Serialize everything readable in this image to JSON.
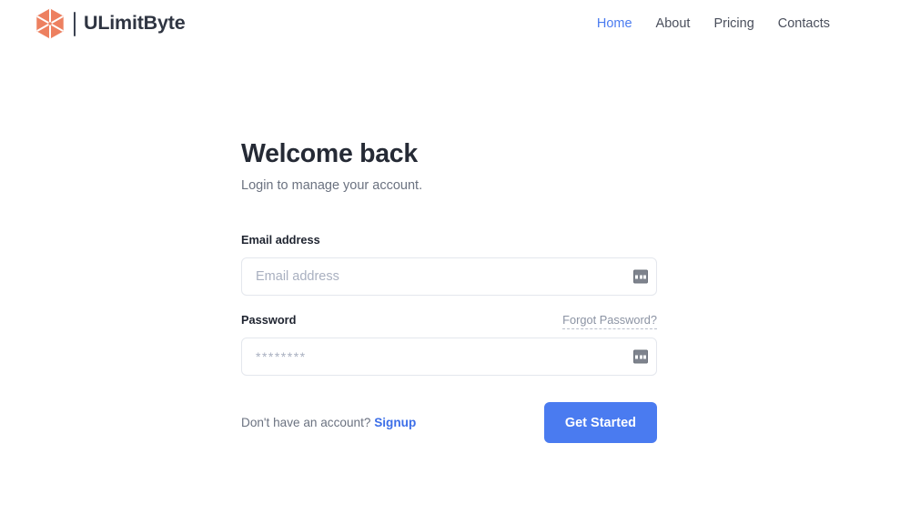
{
  "brand": {
    "name": "ULimitByte",
    "logo_icon": "hexagon-cube-icon",
    "logo_color": "#ed8060"
  },
  "nav": {
    "items": [
      {
        "label": "Home",
        "active": true
      },
      {
        "label": "About",
        "active": false
      },
      {
        "label": "Pricing",
        "active": false
      },
      {
        "label": "Contacts",
        "active": false
      }
    ],
    "active_color": "#4a7bf0",
    "inactive_color": "#4a4f5c"
  },
  "main": {
    "title": "Welcome back",
    "subtitle": "Login to manage your account."
  },
  "form": {
    "email": {
      "label": "Email address",
      "placeholder": "Email address",
      "value": "",
      "adornment_icon": "autofill-dots-icon"
    },
    "password": {
      "label": "Password",
      "placeholder": "********",
      "value": "",
      "adornment_icon": "autofill-dots-icon",
      "forgot_label": "Forgot Password?"
    },
    "signup_prompt": "Don't have an account?",
    "signup_link": "Signup",
    "submit_label": "Get Started",
    "submit_color": "#4a7bf0"
  }
}
